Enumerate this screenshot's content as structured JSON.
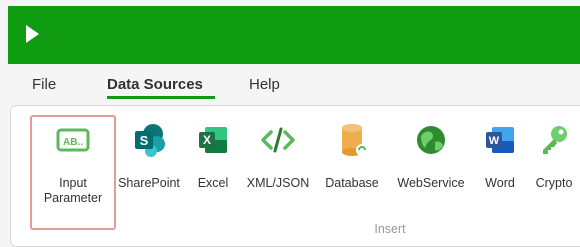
{
  "menu": {
    "file": "File",
    "data_sources": "Data Sources",
    "help": "Help"
  },
  "ribbon": {
    "tools": [
      {
        "label": "Input\nParameter",
        "icon": "input-parameter-icon"
      },
      {
        "label": "SharePoint",
        "icon": "sharepoint-icon"
      },
      {
        "label": "Excel",
        "icon": "excel-icon"
      },
      {
        "label": "XML/JSON",
        "icon": "xml-json-icon"
      },
      {
        "label": "Database",
        "icon": "database-icon"
      },
      {
        "label": "WebService",
        "icon": "globe-icon"
      },
      {
        "label": "Word",
        "icon": "word-icon"
      },
      {
        "label": "Crypto",
        "icon": "key-icon"
      }
    ],
    "group_label": "Insert"
  },
  "icons": {
    "sharepoint": "S",
    "excel": "X",
    "word": "W",
    "input": "AB.."
  },
  "colors": {
    "title_bar": "#109c10",
    "highlight": "#e59a9a",
    "sharepoint": "#0d7377",
    "excel": "#1e7145",
    "word": "#2b579a",
    "accent_green": "#5cb85c"
  }
}
